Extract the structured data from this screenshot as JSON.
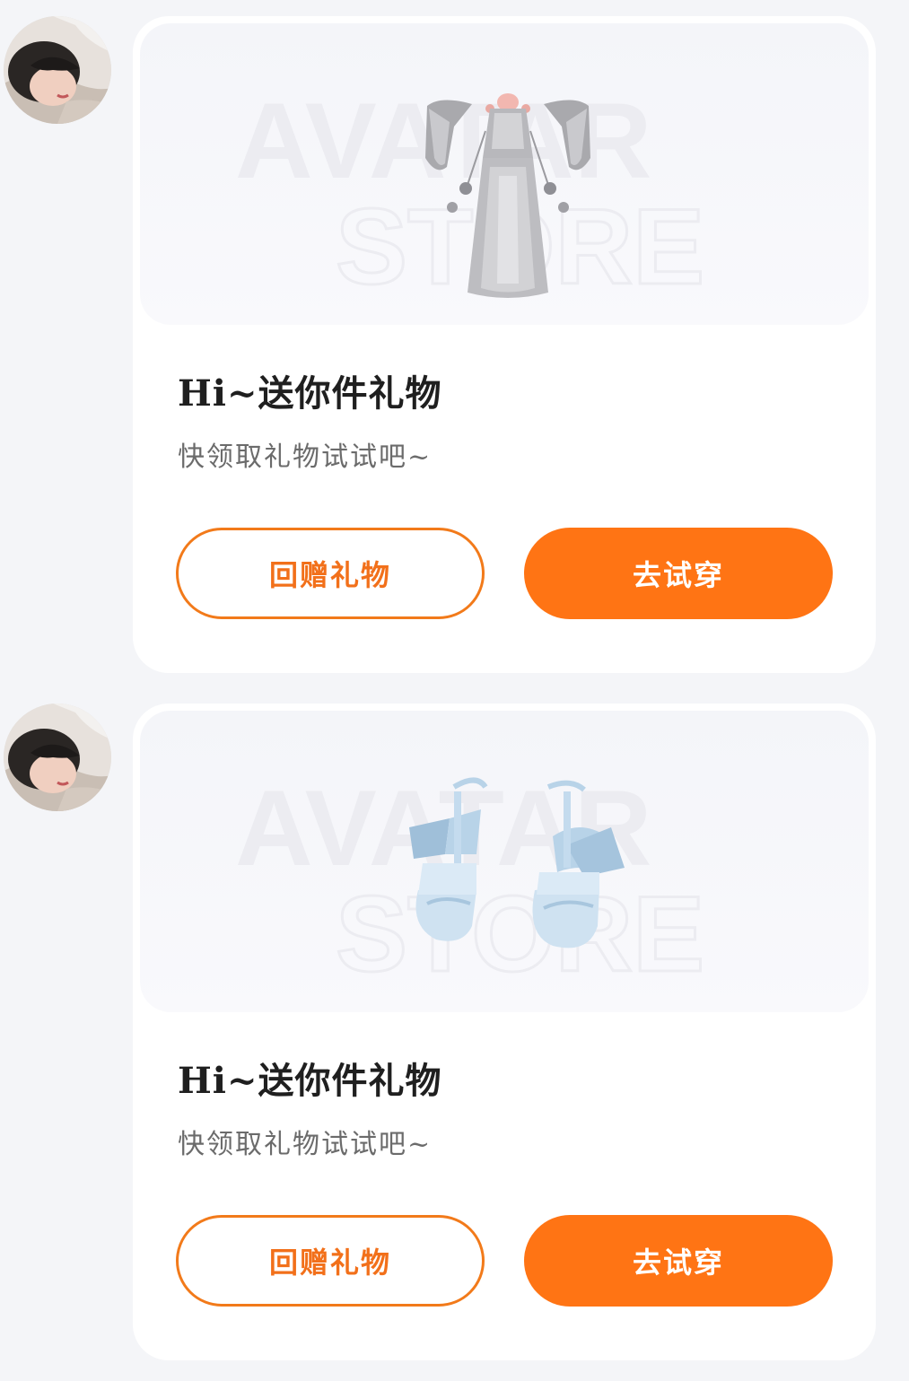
{
  "messages": [
    {
      "item": "dress",
      "avatar_icon": "user-avatar",
      "watermark_line1": "AVATAR",
      "watermark_line2": "STORE",
      "title": "Hi~送你件礼物",
      "subtitle": "快领取礼物试试吧~",
      "return_gift_label": "回赠礼物",
      "try_on_label": "去试穿"
    },
    {
      "item": "shoes",
      "avatar_icon": "user-avatar",
      "watermark_line1": "AVATAR",
      "watermark_line2": "STORE",
      "title": "Hi~送你件礼物",
      "subtitle": "快领取礼物试试吧~",
      "return_gift_label": "回赠礼物",
      "try_on_label": "去试穿"
    }
  ],
  "colors": {
    "accent": "#ff7414",
    "outline": "#f27a1a",
    "page_bg": "#f4f5f8",
    "card_bg": "#ffffff",
    "title": "#1f1f1f",
    "subtitle": "#6b6b6b"
  }
}
